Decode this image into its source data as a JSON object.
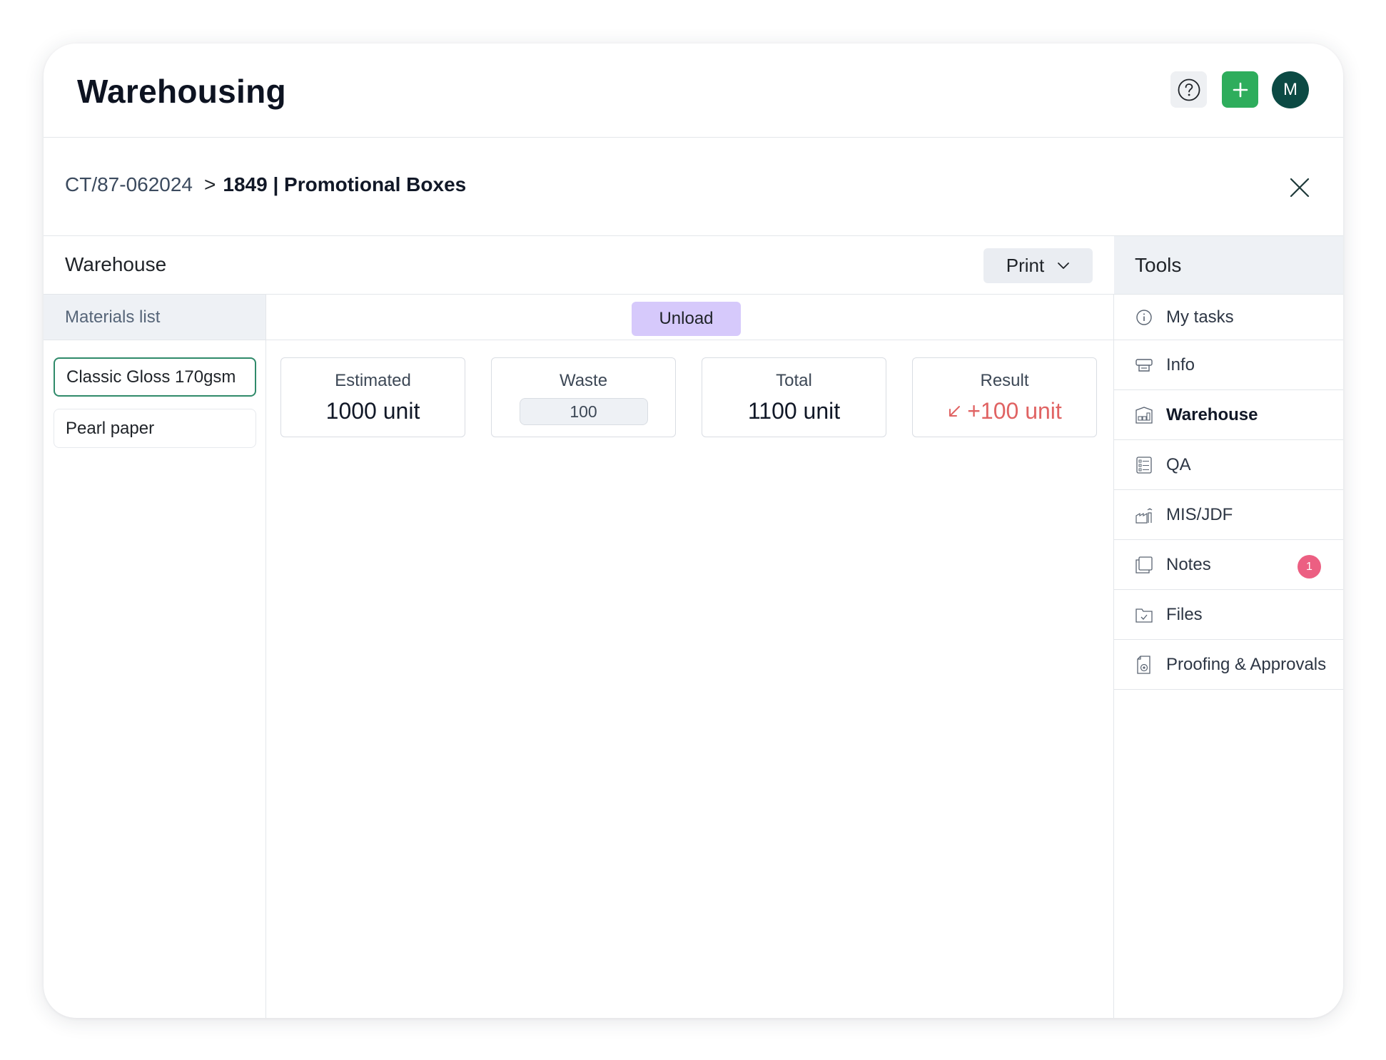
{
  "header": {
    "title": "Warehousing",
    "help_icon": "help-circle-icon",
    "add_icon": "plus-icon",
    "avatar_initial": "M",
    "colors": {
      "add": "#2ead5c",
      "avatar": "#0c4a44"
    }
  },
  "breadcrumb": {
    "parent": "CT/87-062024",
    "separator": ">",
    "current": "1849 | Promotional Boxes"
  },
  "warehouse": {
    "title": "Warehouse",
    "print_label": "Print",
    "materials_header": "Materials list",
    "materials": [
      "Classic Gloss 170gsm",
      "Pearl paper"
    ],
    "selected_material": "Classic Gloss 170gsm",
    "unload_label": "Unload",
    "stats": {
      "estimated": {
        "label": "Estimated",
        "value": "1000 unit"
      },
      "waste": {
        "label": "Waste",
        "value": "100"
      },
      "total": {
        "label": "Total",
        "value": "1100 unit"
      },
      "result": {
        "label": "Result",
        "value": "+100 unit",
        "color": "#e06363"
      }
    }
  },
  "tools": {
    "title": "Tools",
    "items": [
      {
        "label": "My tasks",
        "icon": "info-icon"
      },
      {
        "label": "Info",
        "icon": "printer-icon"
      },
      {
        "label": "Warehouse",
        "icon": "warehouse-icon",
        "active": true
      },
      {
        "label": "QA",
        "icon": "checklist-icon"
      },
      {
        "label": "MIS/JDF",
        "icon": "factory-icon"
      },
      {
        "label": "Notes",
        "icon": "notes-icon",
        "badge": "1"
      },
      {
        "label": "Files",
        "icon": "folder-check-icon"
      },
      {
        "label": "Proofing & Approvals",
        "icon": "proof-document-icon"
      }
    ]
  }
}
